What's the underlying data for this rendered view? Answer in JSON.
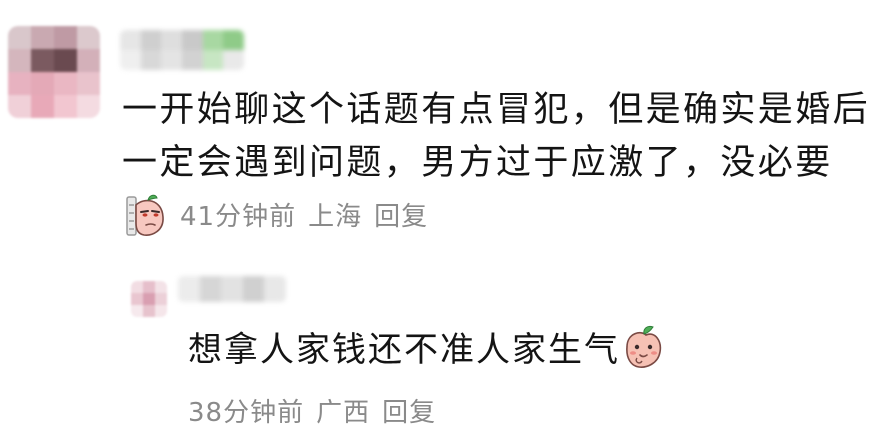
{
  "comment": {
    "text": "一开始聊这个话题有点冒犯，但是确实是婚后一定会遇到问题，男方过于应激了，没必要",
    "sticker_icon": "peeking-peach-sticker-icon",
    "time": "41分钟前",
    "location": "上海",
    "reply_label": "回复"
  },
  "reply": {
    "text": "想拿人家钱还不准人家生气",
    "sticker_icon": "peach-sticker-icon",
    "time": "38分钟前",
    "location": "广西",
    "reply_label": "回复"
  },
  "colors": {
    "text": "#141414",
    "meta": "#8a8a8a",
    "avatar_pink": "#e8b7c2",
    "avatar_dark": "#6e4a4f",
    "username_green": "#9ed29a"
  }
}
